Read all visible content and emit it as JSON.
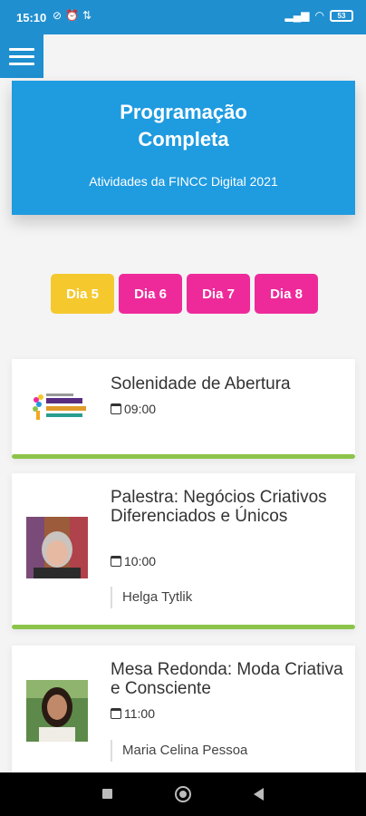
{
  "status_bar": {
    "time": "15:10",
    "left_icons": [
      "blocked-icon",
      "alarm-icon",
      "data-icon"
    ],
    "right_icons": [
      "signal-icon",
      "wifi-icon"
    ],
    "battery": "53"
  },
  "header": {
    "menu_icon": "hamburger-menu-icon"
  },
  "hero": {
    "title": "Programação Completa",
    "subtitle": "Atividades da FINCC Digital 2021"
  },
  "day_tabs": [
    {
      "label": "Dia 5",
      "active": true
    },
    {
      "label": "Dia 6",
      "active": false
    },
    {
      "label": "Dia 7",
      "active": false
    },
    {
      "label": "Dia 8",
      "active": false
    }
  ],
  "events": [
    {
      "title": "Solenidade de Abertura",
      "time": "09:00",
      "speaker": "",
      "thumb_text": "negócios criativos"
    },
    {
      "title": "Palestra: Negócios Criativos Diferenciados e Únicos",
      "time": "10:00",
      "speaker": "Helga Tytlik"
    },
    {
      "title": "Mesa Redonda: Moda Criativa e Consciente",
      "time": "11:00",
      "speaker": "Maria Celina Pessoa"
    }
  ],
  "colors": {
    "primary_blue": "#1f9be0",
    "active_tab": "#f5c92e",
    "inactive_tab": "#ee2a9b",
    "card_accent": "#8cc44a"
  },
  "nav_bar": {
    "icons": [
      "recent-apps-icon",
      "home-icon",
      "back-icon"
    ]
  }
}
